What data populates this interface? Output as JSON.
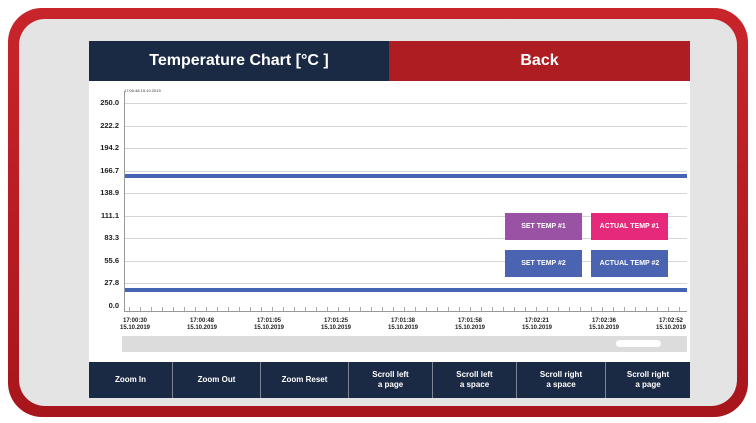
{
  "header": {
    "title": "Temperature Chart [°C ]",
    "back_label": "Back"
  },
  "chart_data": {
    "type": "line",
    "timestamp_label": "17:00:48 15.10.2019",
    "y_ticks": [
      "250.0",
      "222.2",
      "194.2",
      "166.7",
      "138.9",
      "111.1",
      "83.3",
      "55.6",
      "27.8",
      "0.0"
    ],
    "ylim": [
      0,
      250
    ],
    "x_ticks": [
      {
        "time": "17:00:30",
        "date": "15.10.2019"
      },
      {
        "time": "17:00:48",
        "date": "15.10.2019"
      },
      {
        "time": "17:01:05",
        "date": "15.10.2019"
      },
      {
        "time": "17:01:25",
        "date": "15.10.2019"
      },
      {
        "time": "17:01:38",
        "date": "15.10.2019"
      },
      {
        "time": "17:01:58",
        "date": "15.10.2019"
      },
      {
        "time": "17:02:21",
        "date": "15.10.2019"
      },
      {
        "time": "17:02:36",
        "date": "15.10.2019"
      },
      {
        "time": "17:02:52",
        "date": "15.10.2019"
      }
    ],
    "series": [
      {
        "name": "SET TEMP #1",
        "color": "#9a52a4",
        "value": 160
      },
      {
        "name": "ACTUAL TEMP #1",
        "color": "#e7297b",
        "value": 160
      },
      {
        "name": "SET TEMP #2",
        "color": "#4a64b2",
        "value": 20
      },
      {
        "name": "ACTUAL TEMP #2",
        "color": "#4a64b2",
        "value": 20
      }
    ],
    "grid": true,
    "legend": "bottom-right"
  },
  "scrollbar": {
    "position": 0.95
  },
  "toolbar": {
    "zoom_in": "Zoom In",
    "zoom_out": "Zoom Out",
    "zoom_reset": "Zoom Reset",
    "scroll_left_page": [
      "Scroll left",
      "a page"
    ],
    "scroll_left_space": [
      "Scroll left",
      "a space"
    ],
    "scroll_right_space": [
      "Scroll right",
      "a space"
    ],
    "scroll_right_page": [
      "Scroll right",
      "a page"
    ]
  }
}
